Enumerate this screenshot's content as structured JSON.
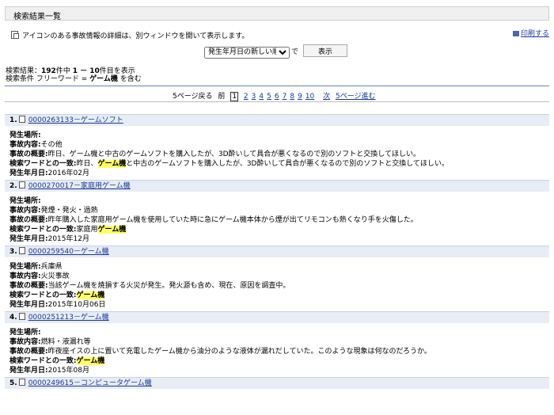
{
  "page_title": "検索結果一覧",
  "info_text": "アイコンのある事故情報の詳細は、別ウィンドウを開いて表示します。",
  "print_label": "印刷する",
  "sort": {
    "selected": "発生年月日の新しい順",
    "suffix": "で",
    "button": "表示"
  },
  "summary": {
    "line1_prefix": "検索結果：",
    "total": "192",
    "line1_mid": "件中 ",
    "range": "1 － 10",
    "line1_suffix": "件目を表示",
    "line2_prefix": "検索条件 フリーワード = ",
    "keyword": "ゲーム機",
    "line2_suffix": " を含む"
  },
  "pager": {
    "back5": "5ページ戻る",
    "prev": "前",
    "current": "1",
    "pages": [
      "2",
      "3",
      "4",
      "5",
      "6",
      "7",
      "8",
      "9",
      "10"
    ],
    "next": "次",
    "forward5": "5ページ進む"
  },
  "labels": {
    "place": "発生場所:",
    "content": "事故内容:",
    "summary": "事故の概要:",
    "match": "検索ワードとの一致:",
    "date": "発生年月日:"
  },
  "results": [
    {
      "num": "1.",
      "link": "0000263133－ゲームソフト",
      "place": "",
      "content": "その他",
      "summary": "昨日、ゲーム機と中古のゲームソフトを購入したが、3D酔いして具合が悪くなるので別のソフトと交換してほしい。",
      "match_pre": "昨日、",
      "match_hl": "ゲーム機",
      "match_post": "と中古のゲームソフトを購入したが、3D酔いして具合が悪くなるので別のソフトと交換してほしい。",
      "date": "2016年02月"
    },
    {
      "num": "2.",
      "link": "0000270017－家庭用ゲーム機",
      "place": "",
      "content": "発煙・発火・過熱",
      "summary": "昨年購入した家庭用ゲーム機を使用していた時に急にゲーム機本体から煙が出てリモコンも熱くなり手を火傷した。",
      "match_pre": "家庭用",
      "match_hl": "ゲーム機",
      "match_post": "",
      "date": "2015年12月"
    },
    {
      "num": "3.",
      "link": "0000259540－ゲーム機",
      "place": "兵庫県",
      "content": "火災事故",
      "summary": "当該ゲーム機を焼損する火災が発生。発火源も含め、現在、原因を調査中。",
      "match_pre": "",
      "match_hl": "ゲーム機",
      "match_post": "",
      "date": "2015年10月06日"
    },
    {
      "num": "4.",
      "link": "0000251213－ゲーム機",
      "place": "",
      "content": "燃料・液漏れ等",
      "summary": "昨夜座イスの上に置いて充電したゲーム機から油分のような液体が漏れだしていた。このような現象は何なのだろうか。",
      "match_pre": "",
      "match_hl": "ゲーム機",
      "match_post": "",
      "date": "2015年08月"
    },
    {
      "num": "5.",
      "link": "0000249615－コンピュータゲーム機",
      "place": "",
      "content": "",
      "summary": "",
      "match_pre": "",
      "match_hl": "",
      "match_post": "",
      "date": ""
    }
  ]
}
